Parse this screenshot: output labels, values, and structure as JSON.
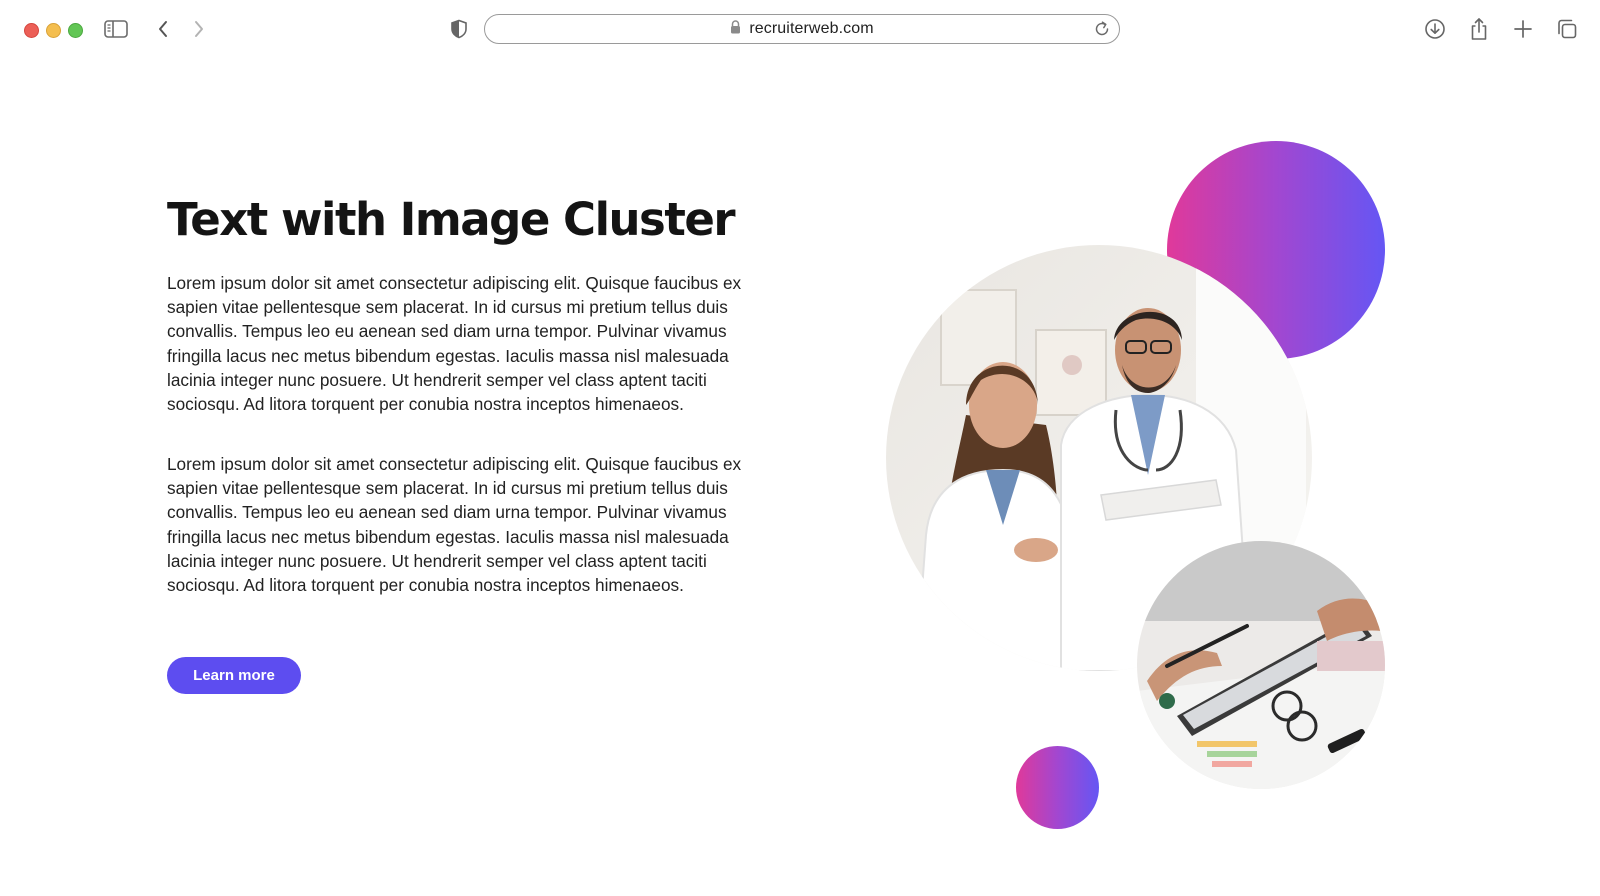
{
  "browser": {
    "url": "recruiterweb.com"
  },
  "page": {
    "title": "Text with Image Cluster",
    "paragraphs": [
      "Lorem ipsum dolor sit amet consectetur adipiscing elit. Quisque faucibus ex sapien vitae pellentesque sem placerat. In id cursus mi pretium tellus duis convallis. Tempus leo eu aenean sed diam urna tempor. Pulvinar vivamus fringilla lacus nec metus bibendum egestas. Iaculis massa nisl malesuada lacinia integer nunc posuere. Ut hendrerit semper vel class aptent taciti sociosqu. Ad litora torquent per conubia nostra inceptos himenaeos.",
      "Lorem ipsum dolor sit amet consectetur adipiscing elit. Quisque faucibus ex sapien vitae pellentesque sem placerat. In id cursus mi pretium tellus duis convallis. Tempus leo eu aenean sed diam urna tempor. Pulvinar vivamus fringilla lacus nec metus bibendum egestas. Iaculis massa nisl malesuada lacinia integer nunc posuere. Ut hendrerit semper vel class aptent taciti sociosqu. Ad litora torquent per conubia nostra inceptos himenaeos."
    ],
    "cta_label": "Learn more"
  },
  "colors": {
    "button": "#5d4df0",
    "gradient_start": "#e0399a",
    "gradient_end": "#6556f4"
  },
  "icons": {
    "sidebar": "sidebar-icon",
    "back": "chevron-left-icon",
    "forward": "chevron-right-icon",
    "privacy": "shield-icon",
    "lock": "lock-icon",
    "reload": "reload-icon",
    "download": "download-icon",
    "share": "share-icon",
    "new_tab": "plus-icon",
    "tabs": "tabs-overview-icon"
  }
}
